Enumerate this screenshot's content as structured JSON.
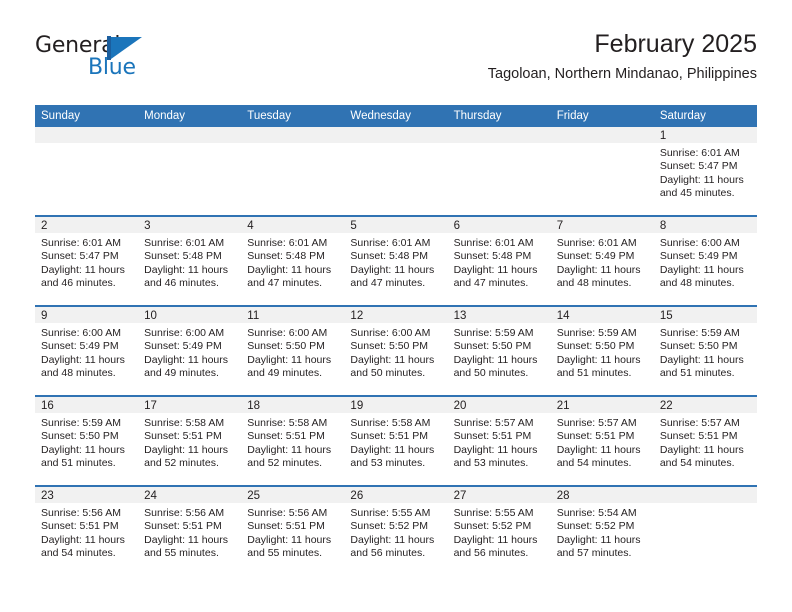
{
  "logo": {
    "word_top": "General",
    "word_bottom": "Blue",
    "brand_color": "#1b75bb",
    "mark_icon": "flag-triangle-icon"
  },
  "header": {
    "title": "February 2025",
    "subtitle": "Tagoloan, Northern Mindanao, Philippines"
  },
  "theme": {
    "header_blue": "#3073b3",
    "daynum_band_gray": "#f1f1f1",
    "text": "#231f20"
  },
  "weekdays": [
    "Sunday",
    "Monday",
    "Tuesday",
    "Wednesday",
    "Thursday",
    "Friday",
    "Saturday"
  ],
  "weeks": [
    [
      {
        "day": "",
        "blank": true
      },
      {
        "day": "",
        "blank": true
      },
      {
        "day": "",
        "blank": true
      },
      {
        "day": "",
        "blank": true
      },
      {
        "day": "",
        "blank": true
      },
      {
        "day": "",
        "blank": true
      },
      {
        "day": "1",
        "sunrise": "Sunrise: 6:01 AM",
        "sunset": "Sunset: 5:47 PM",
        "daylight1": "Daylight: 11 hours",
        "daylight2": "and 45 minutes."
      }
    ],
    [
      {
        "day": "2",
        "sunrise": "Sunrise: 6:01 AM",
        "sunset": "Sunset: 5:47 PM",
        "daylight1": "Daylight: 11 hours",
        "daylight2": "and 46 minutes."
      },
      {
        "day": "3",
        "sunrise": "Sunrise: 6:01 AM",
        "sunset": "Sunset: 5:48 PM",
        "daylight1": "Daylight: 11 hours",
        "daylight2": "and 46 minutes."
      },
      {
        "day": "4",
        "sunrise": "Sunrise: 6:01 AM",
        "sunset": "Sunset: 5:48 PM",
        "daylight1": "Daylight: 11 hours",
        "daylight2": "and 47 minutes."
      },
      {
        "day": "5",
        "sunrise": "Sunrise: 6:01 AM",
        "sunset": "Sunset: 5:48 PM",
        "daylight1": "Daylight: 11 hours",
        "daylight2": "and 47 minutes."
      },
      {
        "day": "6",
        "sunrise": "Sunrise: 6:01 AM",
        "sunset": "Sunset: 5:48 PM",
        "daylight1": "Daylight: 11 hours",
        "daylight2": "and 47 minutes."
      },
      {
        "day": "7",
        "sunrise": "Sunrise: 6:01 AM",
        "sunset": "Sunset: 5:49 PM",
        "daylight1": "Daylight: 11 hours",
        "daylight2": "and 48 minutes."
      },
      {
        "day": "8",
        "sunrise": "Sunrise: 6:00 AM",
        "sunset": "Sunset: 5:49 PM",
        "daylight1": "Daylight: 11 hours",
        "daylight2": "and 48 minutes."
      }
    ],
    [
      {
        "day": "9",
        "sunrise": "Sunrise: 6:00 AM",
        "sunset": "Sunset: 5:49 PM",
        "daylight1": "Daylight: 11 hours",
        "daylight2": "and 48 minutes."
      },
      {
        "day": "10",
        "sunrise": "Sunrise: 6:00 AM",
        "sunset": "Sunset: 5:49 PM",
        "daylight1": "Daylight: 11 hours",
        "daylight2": "and 49 minutes."
      },
      {
        "day": "11",
        "sunrise": "Sunrise: 6:00 AM",
        "sunset": "Sunset: 5:50 PM",
        "daylight1": "Daylight: 11 hours",
        "daylight2": "and 49 minutes."
      },
      {
        "day": "12",
        "sunrise": "Sunrise: 6:00 AM",
        "sunset": "Sunset: 5:50 PM",
        "daylight1": "Daylight: 11 hours",
        "daylight2": "and 50 minutes."
      },
      {
        "day": "13",
        "sunrise": "Sunrise: 5:59 AM",
        "sunset": "Sunset: 5:50 PM",
        "daylight1": "Daylight: 11 hours",
        "daylight2": "and 50 minutes."
      },
      {
        "day": "14",
        "sunrise": "Sunrise: 5:59 AM",
        "sunset": "Sunset: 5:50 PM",
        "daylight1": "Daylight: 11 hours",
        "daylight2": "and 51 minutes."
      },
      {
        "day": "15",
        "sunrise": "Sunrise: 5:59 AM",
        "sunset": "Sunset: 5:50 PM",
        "daylight1": "Daylight: 11 hours",
        "daylight2": "and 51 minutes."
      }
    ],
    [
      {
        "day": "16",
        "sunrise": "Sunrise: 5:59 AM",
        "sunset": "Sunset: 5:50 PM",
        "daylight1": "Daylight: 11 hours",
        "daylight2": "and 51 minutes."
      },
      {
        "day": "17",
        "sunrise": "Sunrise: 5:58 AM",
        "sunset": "Sunset: 5:51 PM",
        "daylight1": "Daylight: 11 hours",
        "daylight2": "and 52 minutes."
      },
      {
        "day": "18",
        "sunrise": "Sunrise: 5:58 AM",
        "sunset": "Sunset: 5:51 PM",
        "daylight1": "Daylight: 11 hours",
        "daylight2": "and 52 minutes."
      },
      {
        "day": "19",
        "sunrise": "Sunrise: 5:58 AM",
        "sunset": "Sunset: 5:51 PM",
        "daylight1": "Daylight: 11 hours",
        "daylight2": "and 53 minutes."
      },
      {
        "day": "20",
        "sunrise": "Sunrise: 5:57 AM",
        "sunset": "Sunset: 5:51 PM",
        "daylight1": "Daylight: 11 hours",
        "daylight2": "and 53 minutes."
      },
      {
        "day": "21",
        "sunrise": "Sunrise: 5:57 AM",
        "sunset": "Sunset: 5:51 PM",
        "daylight1": "Daylight: 11 hours",
        "daylight2": "and 54 minutes."
      },
      {
        "day": "22",
        "sunrise": "Sunrise: 5:57 AM",
        "sunset": "Sunset: 5:51 PM",
        "daylight1": "Daylight: 11 hours",
        "daylight2": "and 54 minutes."
      }
    ],
    [
      {
        "day": "23",
        "sunrise": "Sunrise: 5:56 AM",
        "sunset": "Sunset: 5:51 PM",
        "daylight1": "Daylight: 11 hours",
        "daylight2": "and 54 minutes."
      },
      {
        "day": "24",
        "sunrise": "Sunrise: 5:56 AM",
        "sunset": "Sunset: 5:51 PM",
        "daylight1": "Daylight: 11 hours",
        "daylight2": "and 55 minutes."
      },
      {
        "day": "25",
        "sunrise": "Sunrise: 5:56 AM",
        "sunset": "Sunset: 5:51 PM",
        "daylight1": "Daylight: 11 hours",
        "daylight2": "and 55 minutes."
      },
      {
        "day": "26",
        "sunrise": "Sunrise: 5:55 AM",
        "sunset": "Sunset: 5:52 PM",
        "daylight1": "Daylight: 11 hours",
        "daylight2": "and 56 minutes."
      },
      {
        "day": "27",
        "sunrise": "Sunrise: 5:55 AM",
        "sunset": "Sunset: 5:52 PM",
        "daylight1": "Daylight: 11 hours",
        "daylight2": "and 56 minutes."
      },
      {
        "day": "28",
        "sunrise": "Sunrise: 5:54 AM",
        "sunset": "Sunset: 5:52 PM",
        "daylight1": "Daylight: 11 hours",
        "daylight2": "and 57 minutes."
      },
      {
        "day": "",
        "blank": true
      }
    ]
  ]
}
